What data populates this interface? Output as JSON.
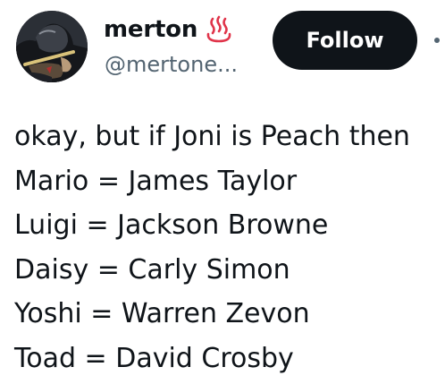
{
  "author": {
    "display_name": "merton",
    "name_emoji": "hot-springs-icon",
    "handle": "@mertone..."
  },
  "actions": {
    "follow_label": "Follow",
    "more_icon": "more-dots-icon"
  },
  "tweet": {
    "lines": [
      "okay, but if Joni is Peach then",
      "Mario = James Taylor",
      "Luigi = Jackson Browne",
      "Daisy = Carly Simon",
      "Yoshi = Warren Zevon",
      "Toad = David Crosby"
    ]
  },
  "colors": {
    "text": "#0f1419",
    "secondary": "#536471",
    "follow_bg": "#0f1419",
    "emoji_red": "#e0344a"
  }
}
